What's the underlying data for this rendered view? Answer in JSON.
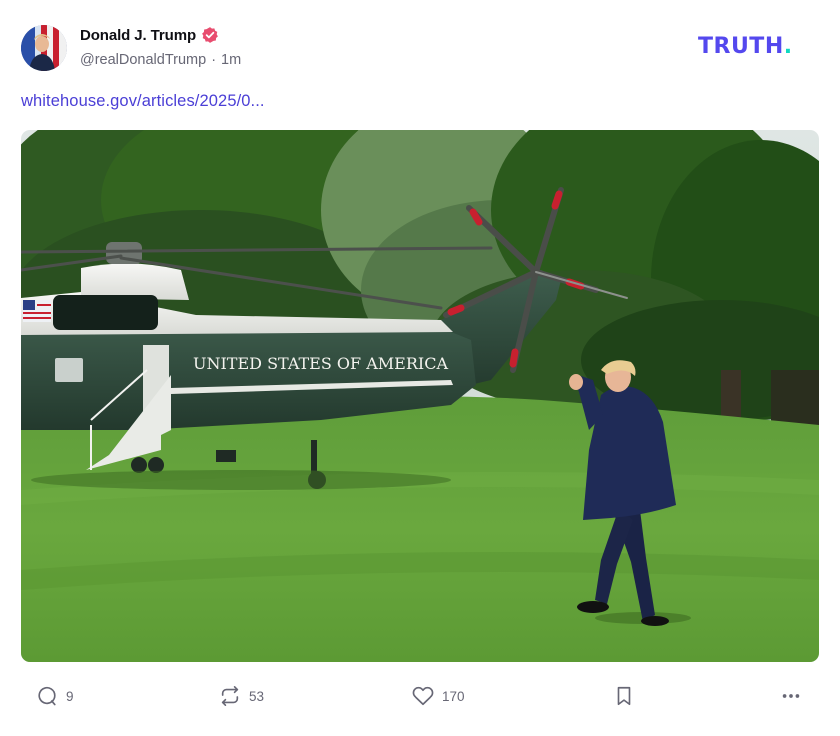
{
  "author": {
    "display_name": "Donald J. Trump",
    "handle": "@realDonaldTrump",
    "separator": "·",
    "timestamp": "1m",
    "verified_icon": "verified-badge-icon",
    "avatar_icon": "profile-avatar"
  },
  "brand": {
    "logo_text": "TRUTH",
    "logo_dot": ".",
    "color_primary": "#5448ee",
    "color_dot": "#10d9c1"
  },
  "post": {
    "link_text": "whitehouse.gov/articles/2025/0...",
    "image": {
      "helicopter_marking": "UNITED STATES OF AMERICA"
    }
  },
  "actions": {
    "reply": {
      "icon": "reply-bubble-icon",
      "count": "9"
    },
    "retruth": {
      "icon": "retruth-icon",
      "count": "53"
    },
    "like": {
      "icon": "heart-icon",
      "count": "170"
    },
    "bookmark": {
      "icon": "bookmark-icon"
    },
    "more": {
      "icon": "more-dots-icon"
    }
  },
  "colors": {
    "link": "#4b3fd6",
    "muted": "#676775",
    "verified": "#e84d6f"
  }
}
